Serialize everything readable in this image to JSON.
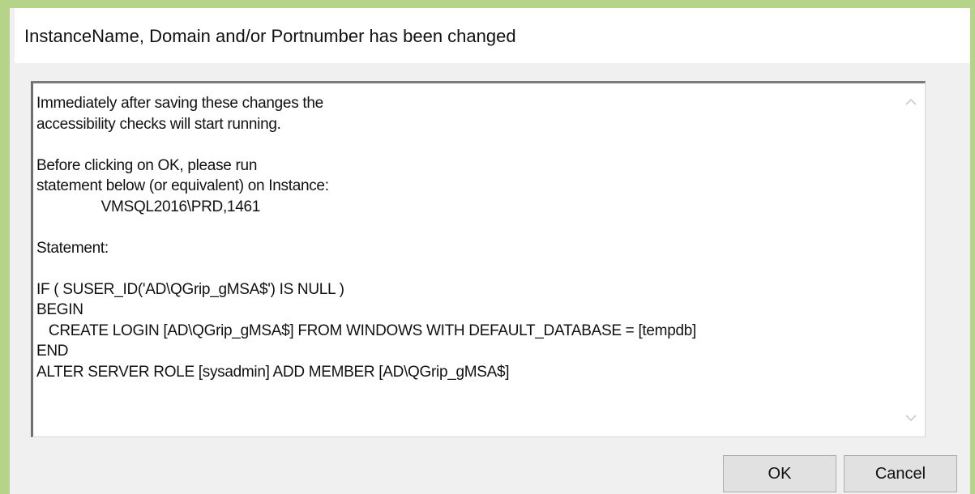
{
  "dialog": {
    "title": "InstanceName, Domain and/or Portnumber has been changed",
    "message": "Immediately after saving these changes the\naccessibility checks will start running.\n\nBefore clicking on OK, please run\nstatement below (or equivalent) on Instance:\n\t\tVMSQL2016\\PRD,1461\n\nStatement:\n\nIF ( SUSER_ID('AD\\QGrip_gMSA$') IS NULL )\nBEGIN\n   CREATE LOGIN [AD\\QGrip_gMSA$] FROM WINDOWS WITH DEFAULT_DATABASE = [tempdb]\nEND\nALTER SERVER ROLE [sysadmin] ADD MEMBER [AD\\QGrip_gMSA$]",
    "ok_label": "OK",
    "cancel_label": "Cancel"
  },
  "icons": {
    "scroll_up": "chevron-up-icon",
    "scroll_down": "chevron-down-icon"
  },
  "colors": {
    "outer_border": "#b6d38a",
    "dialog_background": "#f0f0f0",
    "button_background": "#e1e1e1"
  }
}
